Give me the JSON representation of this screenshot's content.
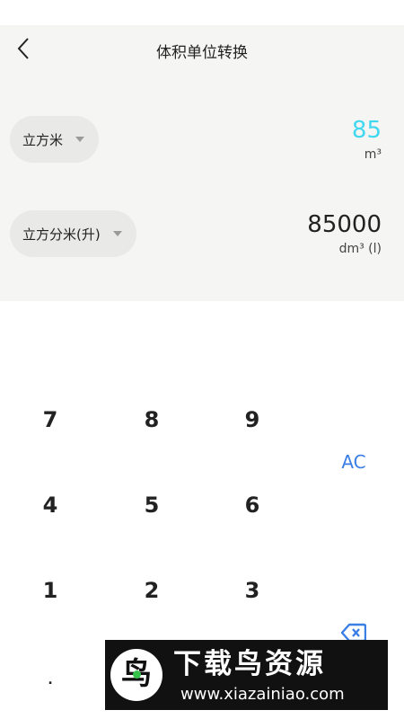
{
  "header": {
    "title": "体积单位转换",
    "back_icon": "back-chevron-icon"
  },
  "from": {
    "unit_label": "立方米",
    "value": "85",
    "unit_symbol": "m³",
    "value_color": "#3fd8f0"
  },
  "to": {
    "unit_label": "立方分米(升)",
    "value": "85000",
    "unit_symbol": "dm³ (l)"
  },
  "keypad": {
    "keys": [
      "7",
      "8",
      "9",
      "4",
      "5",
      "6",
      "1",
      "2",
      "3",
      "."
    ],
    "clear_label": "AC",
    "clear_color": "#3a7ee6",
    "backspace_icon": "backspace-icon"
  },
  "watermark": {
    "title": "下载鸟资源",
    "url": "www.xiazainiao.com",
    "logo_char": "鸟"
  }
}
